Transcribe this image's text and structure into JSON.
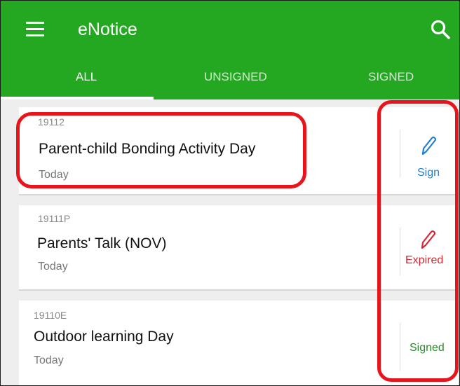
{
  "app": {
    "title": "eNotice"
  },
  "icons": {
    "menu": "menu-icon",
    "search": "search-icon",
    "pencil": "pencil-icon"
  },
  "colors": {
    "appbar": "#24a821",
    "sign": "#1f7fd6",
    "expired": "#d6262f",
    "signed": "#2e8a2e",
    "annotation": "#e8141c"
  },
  "tabs": [
    {
      "label": "ALL",
      "selected": true
    },
    {
      "label": "UNSIGNED",
      "selected": false
    },
    {
      "label": "SIGNED",
      "selected": false
    }
  ],
  "notices": [
    {
      "id": "19112",
      "title": "Parent-child Bonding Activity Day",
      "date": "Today",
      "status": "Sign"
    },
    {
      "id": "19111P",
      "title": "Parents' Talk (NOV)",
      "date": "Today",
      "status": "Expired"
    },
    {
      "id": "19110E",
      "title": "Outdoor learning Day",
      "date": "Today",
      "status": "Signed"
    }
  ]
}
